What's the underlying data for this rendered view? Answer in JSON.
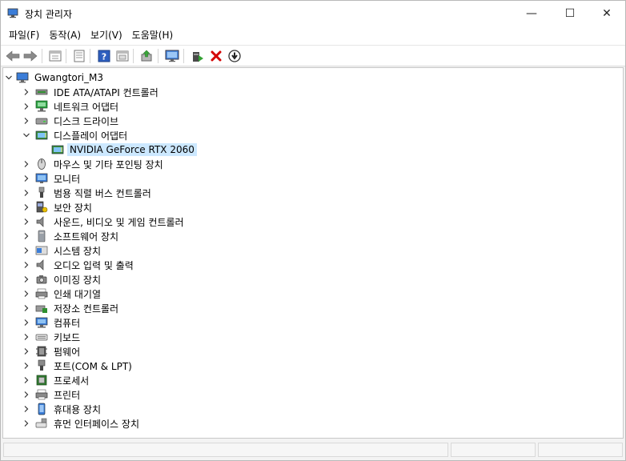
{
  "window": {
    "title": "장치 관리자",
    "min_icon": "minimize-icon",
    "max_icon": "maximize-icon",
    "close_icon": "close-icon",
    "min_glyph": "—",
    "max_glyph": "☐",
    "close_glyph": "✕"
  },
  "menu": [
    "파일(F)",
    "동작(A)",
    "보기(V)",
    "도움말(H)"
  ],
  "toolbar": [
    {
      "icon": "back-arrow-icon"
    },
    {
      "icon": "forward-arrow-icon"
    },
    {
      "icon": "device-view-icon"
    },
    {
      "icon": "properties-icon"
    },
    {
      "icon": "help-icon"
    },
    {
      "icon": "action-view-icon"
    },
    {
      "icon": "update-driver-icon"
    },
    {
      "icon": "scan-hardware-icon"
    },
    {
      "icon": "enable-device-icon"
    },
    {
      "icon": "uninstall-icon"
    },
    {
      "icon": "download-icon"
    }
  ],
  "tree": {
    "root": "Gwangtori_M3",
    "categories": [
      {
        "label": "IDE ATA/ATAPI 컨트롤러",
        "icon": "ide-controller-icon",
        "expanded": false
      },
      {
        "label": "네트워크 어댑터",
        "icon": "network-adapter-icon",
        "expanded": false
      },
      {
        "label": "디스크 드라이브",
        "icon": "disk-drive-icon",
        "expanded": false
      },
      {
        "label": "디스플레이 어댑터",
        "icon": "display-adapter-icon",
        "expanded": true,
        "children": [
          {
            "label": "NVIDIA GeForce RTX 2060",
            "icon": "display-adapter-icon",
            "selected": true
          }
        ]
      },
      {
        "label": "마우스 및 기타 포인팅 장치",
        "icon": "mouse-icon",
        "expanded": false
      },
      {
        "label": "모니터",
        "icon": "monitor-icon",
        "expanded": false
      },
      {
        "label": "범용 직렬 버스 컨트롤러",
        "icon": "usb-icon",
        "expanded": false
      },
      {
        "label": "보안 장치",
        "icon": "security-device-icon",
        "expanded": false
      },
      {
        "label": "사운드, 비디오 및 게임 컨트롤러",
        "icon": "speaker-icon",
        "expanded": false
      },
      {
        "label": "소프트웨어 장치",
        "icon": "software-device-icon",
        "expanded": false
      },
      {
        "label": "시스템 장치",
        "icon": "system-device-icon",
        "expanded": false
      },
      {
        "label": "오디오 입력 및 출력",
        "icon": "audio-io-icon",
        "expanded": false
      },
      {
        "label": "이미징 장치",
        "icon": "camera-icon",
        "expanded": false
      },
      {
        "label": "인쇄 대기열",
        "icon": "print-queue-icon",
        "expanded": false
      },
      {
        "label": "저장소 컨트롤러",
        "icon": "storage-controller-icon",
        "expanded": false
      },
      {
        "label": "컴퓨터",
        "icon": "computer-icon",
        "expanded": false
      },
      {
        "label": "키보드",
        "icon": "keyboard-icon",
        "expanded": false
      },
      {
        "label": "펌웨어",
        "icon": "firmware-icon",
        "expanded": false
      },
      {
        "label": "포트(COM & LPT)",
        "icon": "port-icon",
        "expanded": false
      },
      {
        "label": "프로세서",
        "icon": "processor-icon",
        "expanded": false
      },
      {
        "label": "프린터",
        "icon": "printer-icon",
        "expanded": false
      },
      {
        "label": "휴대용 장치",
        "icon": "portable-device-icon",
        "expanded": false
      },
      {
        "label": "휴먼 인터페이스 장치",
        "icon": "hid-icon",
        "expanded": false
      }
    ]
  },
  "colors": {
    "selection": "#cce8ff",
    "accent": "#0078d7",
    "delete_red": "#d40000"
  }
}
